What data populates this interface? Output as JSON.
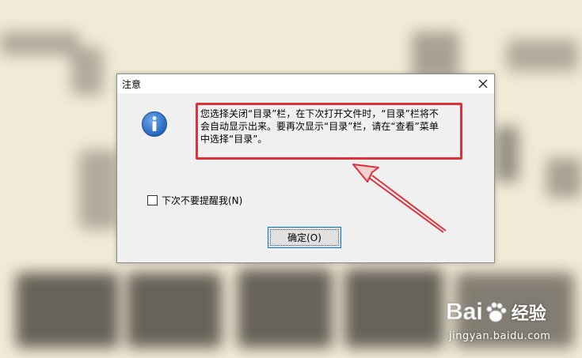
{
  "dialog": {
    "title": "注意",
    "message_lines": [
      "您选择关闭“目录”栏，在下次打开文件时，“目录”栏将不",
      "会自动显示出来。要再次显示“目录”栏，请在“查看”菜单",
      "中选择“目录”。"
    ],
    "checkbox_label": "下次不要提醒我(N)",
    "checkbox_checked": false,
    "ok_label": "确定(O)"
  },
  "annotation": {
    "highlight_color": "#e0303c"
  },
  "watermark": {
    "logo_text": "Bai",
    "brand_text": "经验",
    "url": "jingyan.baidu.com"
  },
  "colors": {
    "dialog_bg": "#f0f0f0",
    "button_border": "#0078d7",
    "info_icon": "#1f63b7"
  }
}
